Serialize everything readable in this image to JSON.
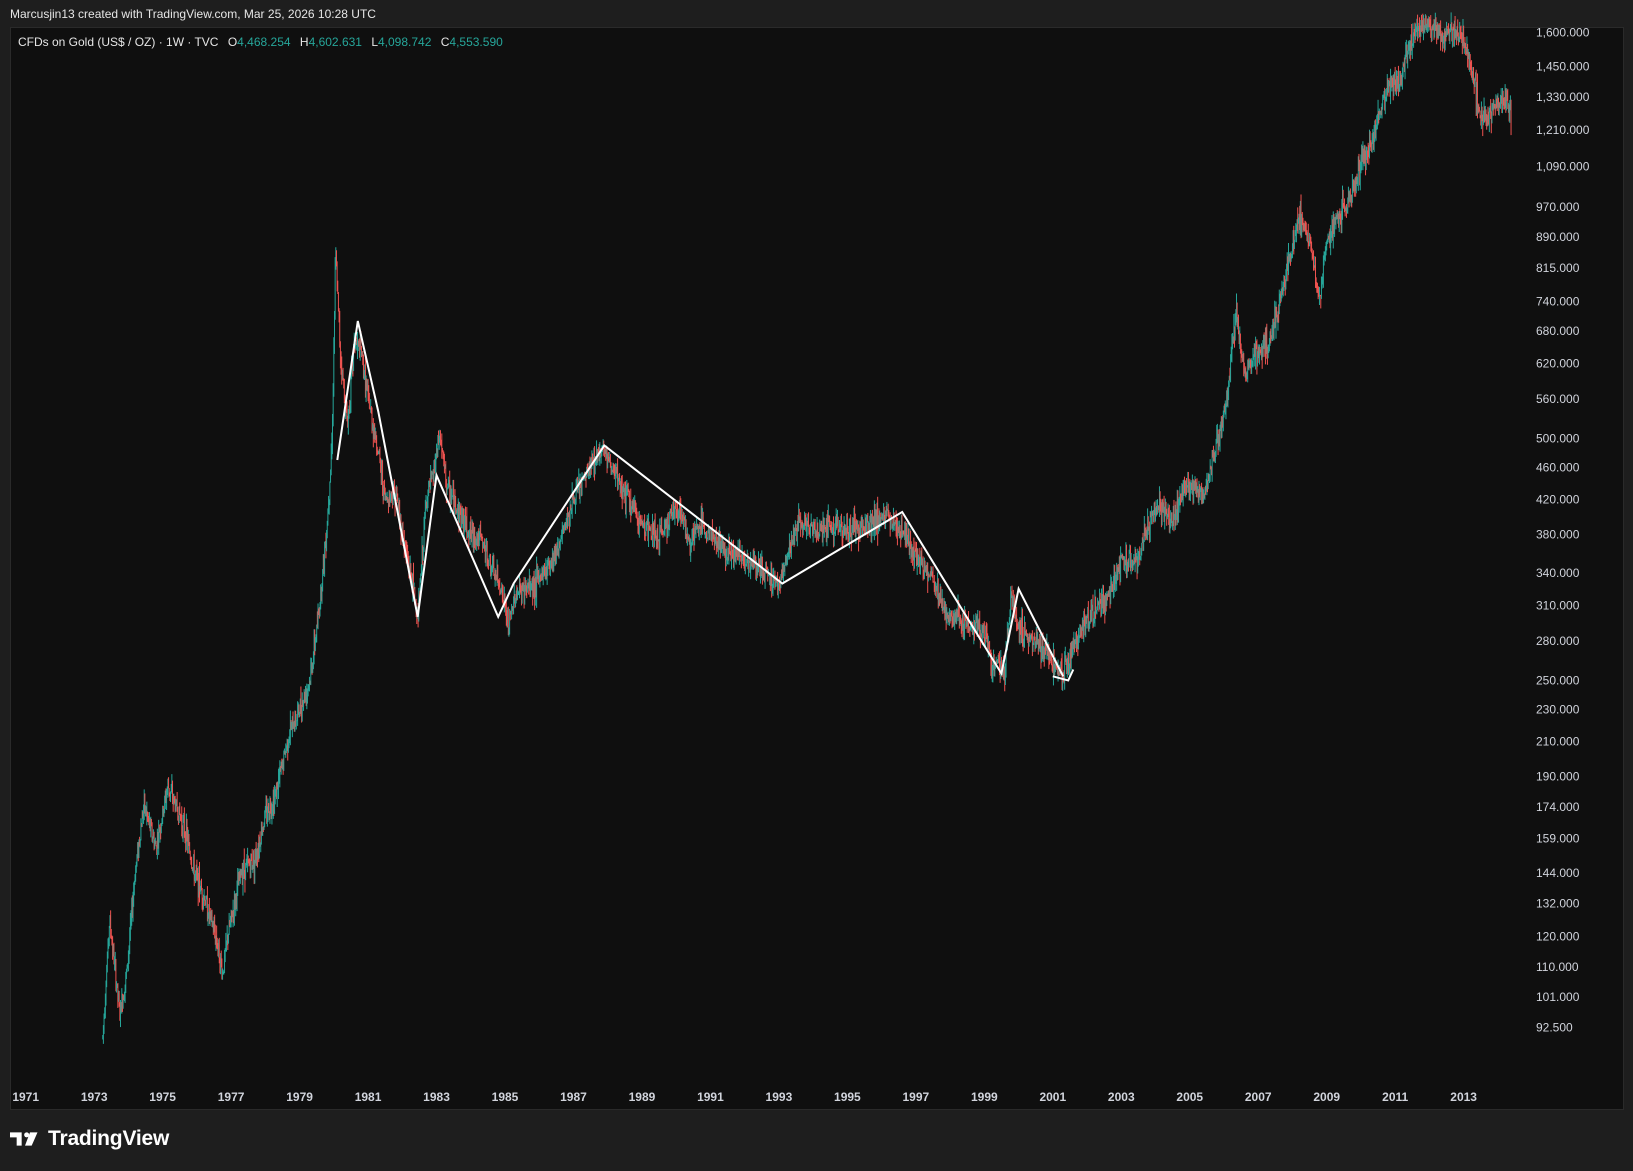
{
  "header": {
    "attribution": "Marcusjin13 created with TradingView.com, Mar 25, 2026 10:28 UTC"
  },
  "legend": {
    "symbol": "CFDs on Gold (US$ / OZ) · 1W · TVC",
    "open_label": "O",
    "open": "4,468.254",
    "high_label": "H",
    "high": "4,602.631",
    "low_label": "L",
    "low": "4,098.742",
    "close_label": "C",
    "close": "4,553.590"
  },
  "brand": {
    "name": "TradingView"
  },
  "colors": {
    "up": "#26a69a",
    "down": "#ef5350",
    "drawing": "#ffffff",
    "background": "#0f0f0f",
    "frame": "#1e1e1e"
  },
  "chart_data": {
    "type": "candlestick",
    "y_scale": "log",
    "ylim": [
      88,
      1620
    ],
    "xlim": [
      1970.6,
      2014.5
    ],
    "y_ticks": [
      {
        "value": 1600,
        "label": "1,600.000"
      },
      {
        "value": 1450,
        "label": "1,450.000"
      },
      {
        "value": 1330,
        "label": "1,330.000"
      },
      {
        "value": 1210,
        "label": "1,210.000"
      },
      {
        "value": 1090,
        "label": "1,090.000"
      },
      {
        "value": 970,
        "label": "970.000"
      },
      {
        "value": 890,
        "label": "890.000"
      },
      {
        "value": 815,
        "label": "815.000"
      },
      {
        "value": 740,
        "label": "740.000"
      },
      {
        "value": 680,
        "label": "680.000"
      },
      {
        "value": 620,
        "label": "620.000"
      },
      {
        "value": 560,
        "label": "560.000"
      },
      {
        "value": 500,
        "label": "500.000"
      },
      {
        "value": 460,
        "label": "460.000"
      },
      {
        "value": 420,
        "label": "420.000"
      },
      {
        "value": 380,
        "label": "380.000"
      },
      {
        "value": 340,
        "label": "340.000"
      },
      {
        "value": 310,
        "label": "310.000"
      },
      {
        "value": 280,
        "label": "280.000"
      },
      {
        "value": 250,
        "label": "250.000"
      },
      {
        "value": 230,
        "label": "230.000"
      },
      {
        "value": 210,
        "label": "210.000"
      },
      {
        "value": 190,
        "label": "190.000"
      },
      {
        "value": 174,
        "label": "174.000"
      },
      {
        "value": 159,
        "label": "159.000"
      },
      {
        "value": 144,
        "label": "144.000"
      },
      {
        "value": 132,
        "label": "132.000"
      },
      {
        "value": 120,
        "label": "120.000"
      },
      {
        "value": 110,
        "label": "110.000"
      },
      {
        "value": 101,
        "label": "101.000"
      },
      {
        "value": 92.5,
        "label": "92.500"
      }
    ],
    "x_ticks": [
      {
        "value": 1971,
        "label": "1971"
      },
      {
        "value": 1973,
        "label": "1973"
      },
      {
        "value": 1975,
        "label": "1975"
      },
      {
        "value": 1977,
        "label": "1977"
      },
      {
        "value": 1979,
        "label": "1979"
      },
      {
        "value": 1981,
        "label": "1981"
      },
      {
        "value": 1983,
        "label": "1983"
      },
      {
        "value": 1985,
        "label": "1985"
      },
      {
        "value": 1987,
        "label": "1987"
      },
      {
        "value": 1989,
        "label": "1989"
      },
      {
        "value": 1991,
        "label": "1991"
      },
      {
        "value": 1993,
        "label": "1993"
      },
      {
        "value": 1995,
        "label": "1995"
      },
      {
        "value": 1997,
        "label": "1997"
      },
      {
        "value": 1999,
        "label": "1999"
      },
      {
        "value": 2001,
        "label": "2001"
      },
      {
        "value": 2003,
        "label": "2003"
      },
      {
        "value": 2005,
        "label": "2005"
      },
      {
        "value": 2007,
        "label": "2007"
      },
      {
        "value": 2009,
        "label": "2009"
      },
      {
        "value": 2011,
        "label": "2011"
      },
      {
        "value": 2013,
        "label": "2013"
      }
    ],
    "price_path": [
      [
        1973.25,
        90
      ],
      [
        1973.45,
        126
      ],
      [
        1973.75,
        96
      ],
      [
        1973.95,
        108
      ],
      [
        1974.2,
        145
      ],
      [
        1974.45,
        175
      ],
      [
        1974.8,
        155
      ],
      [
        1975.0,
        170
      ],
      [
        1975.15,
        185
      ],
      [
        1975.5,
        170
      ],
      [
        1975.7,
        160
      ],
      [
        1975.9,
        145
      ],
      [
        1976.2,
        135
      ],
      [
        1976.6,
        118
      ],
      [
        1976.75,
        108
      ],
      [
        1976.9,
        120
      ],
      [
        1977.3,
        145
      ],
      [
        1977.7,
        150
      ],
      [
        1978.0,
        170
      ],
      [
        1978.3,
        180
      ],
      [
        1978.7,
        215
      ],
      [
        1979.0,
        230
      ],
      [
        1979.3,
        250
      ],
      [
        1979.55,
        300
      ],
      [
        1979.8,
        390
      ],
      [
        1979.95,
        500
      ],
      [
        1980.05,
        850
      ],
      [
        1980.2,
        630
      ],
      [
        1980.4,
        520
      ],
      [
        1980.6,
        660
      ],
      [
        1980.8,
        640
      ],
      [
        1981.0,
        560
      ],
      [
        1981.3,
        480
      ],
      [
        1981.5,
        420
      ],
      [
        1981.8,
        430
      ],
      [
        1982.0,
        380
      ],
      [
        1982.3,
        330
      ],
      [
        1982.45,
        298
      ],
      [
        1982.7,
        420
      ],
      [
        1982.9,
        450
      ],
      [
        1983.1,
        505
      ],
      [
        1983.3,
        435
      ],
      [
        1983.6,
        410
      ],
      [
        1984.0,
        380
      ],
      [
        1984.3,
        375
      ],
      [
        1984.6,
        345
      ],
      [
        1984.9,
        325
      ],
      [
        1985.1,
        290
      ],
      [
        1985.3,
        320
      ],
      [
        1985.6,
        325
      ],
      [
        1985.9,
        330
      ],
      [
        1986.2,
        345
      ],
      [
        1986.6,
        370
      ],
      [
        1986.9,
        410
      ],
      [
        1987.3,
        445
      ],
      [
        1987.6,
        470
      ],
      [
        1987.85,
        490
      ],
      [
        1988.2,
        450
      ],
      [
        1988.6,
        420
      ],
      [
        1988.9,
        395
      ],
      [
        1989.2,
        385
      ],
      [
        1989.5,
        375
      ],
      [
        1989.8,
        400
      ],
      [
        1990.1,
        410
      ],
      [
        1990.4,
        370
      ],
      [
        1990.7,
        390
      ],
      [
        1991.0,
        380
      ],
      [
        1991.4,
        365
      ],
      [
        1991.8,
        358
      ],
      [
        1992.2,
        350
      ],
      [
        1992.6,
        340
      ],
      [
        1993.0,
        330
      ],
      [
        1993.3,
        360
      ],
      [
        1993.6,
        395
      ],
      [
        1994.0,
        385
      ],
      [
        1994.5,
        390
      ],
      [
        1995.0,
        385
      ],
      [
        1995.5,
        390
      ],
      [
        1996.0,
        400
      ],
      [
        1996.3,
        395
      ],
      [
        1996.7,
        380
      ],
      [
        1997.0,
        355
      ],
      [
        1997.5,
        335
      ],
      [
        1997.9,
        300
      ],
      [
        1998.3,
        300
      ],
      [
        1998.7,
        290
      ],
      [
        1999.0,
        285
      ],
      [
        1999.3,
        262
      ],
      [
        1999.6,
        258
      ],
      [
        1999.8,
        320
      ],
      [
        2000.0,
        290
      ],
      [
        2000.4,
        280
      ],
      [
        2000.8,
        270
      ],
      [
        2001.1,
        262
      ],
      [
        2001.3,
        258
      ],
      [
        2001.7,
        280
      ],
      [
        2002.0,
        300
      ],
      [
        2002.5,
        315
      ],
      [
        2003.0,
        350
      ],
      [
        2003.5,
        355
      ],
      [
        2004.0,
        410
      ],
      [
        2004.5,
        395
      ],
      [
        2004.9,
        440
      ],
      [
        2005.4,
        425
      ],
      [
        2005.8,
        490
      ],
      [
        2006.1,
        560
      ],
      [
        2006.35,
        720
      ],
      [
        2006.6,
        600
      ],
      [
        2007.0,
        640
      ],
      [
        2007.4,
        670
      ],
      [
        2007.8,
        790
      ],
      [
        2008.2,
        950
      ],
      [
        2008.5,
        880
      ],
      [
        2008.8,
        740
      ],
      [
        2009.0,
        880
      ],
      [
        2009.3,
        930
      ],
      [
        2009.7,
        1000
      ],
      [
        2010.0,
        1100
      ],
      [
        2010.4,
        1200
      ],
      [
        2010.8,
        1370
      ],
      [
        2011.1,
        1400
      ],
      [
        2011.4,
        1520
      ],
      [
        2011.65,
        1620
      ],
      [
        2012.0,
        1620
      ],
      [
        2012.4,
        1580
      ],
      [
        2012.8,
        1610
      ],
      [
        2013.0,
        1560
      ],
      [
        2013.3,
        1400
      ],
      [
        2013.5,
        1250
      ],
      [
        2013.8,
        1280
      ],
      [
        2014.0,
        1300
      ],
      [
        2014.2,
        1320
      ],
      [
        2014.4,
        1260
      ]
    ],
    "drawing_path": [
      [
        1980.1,
        470
      ],
      [
        1980.7,
        700
      ],
      [
        1981.3,
        540
      ],
      [
        1982.45,
        300
      ],
      [
        1983.0,
        450
      ],
      [
        1984.8,
        300
      ],
      [
        1985.25,
        330
      ],
      [
        1987.9,
        490
      ],
      [
        1993.1,
        330
      ],
      [
        1996.6,
        405
      ],
      [
        1999.5,
        255
      ],
      [
        2000.0,
        325
      ],
      [
        2001.3,
        253
      ]
    ],
    "arrow": [
      [
        2001.0,
        253
      ],
      [
        2001.45,
        250
      ],
      [
        2001.6,
        258
      ]
    ]
  }
}
